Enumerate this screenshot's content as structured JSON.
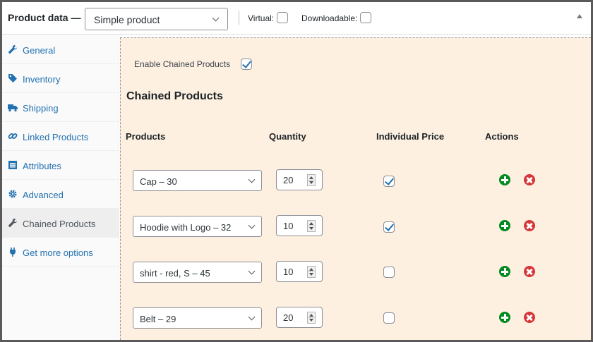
{
  "header": {
    "title": "Product data",
    "dash": "—",
    "product_type": "Simple product",
    "virtual_label": "Virtual:",
    "virtual_checked": false,
    "downloadable_label": "Downloadable:",
    "downloadable_checked": false,
    "collapse_icon": "triangle-up-icon"
  },
  "sidebar": {
    "items": [
      {
        "label": "General",
        "icon": "wrench-icon",
        "active": false
      },
      {
        "label": "Inventory",
        "icon": "tag-icon",
        "active": false
      },
      {
        "label": "Shipping",
        "icon": "truck-icon",
        "active": false
      },
      {
        "label": "Linked Products",
        "icon": "link-icon",
        "active": false
      },
      {
        "label": "Attributes",
        "icon": "list-icon",
        "active": false
      },
      {
        "label": "Advanced",
        "icon": "gear-icon",
        "active": false
      },
      {
        "label": "Chained Products",
        "icon": "wrench-icon",
        "active": true
      },
      {
        "label": "Get more options",
        "icon": "plugin-icon",
        "active": false
      }
    ]
  },
  "panel": {
    "enable_label": "Enable Chained Products",
    "enable_checked": true,
    "section_title": "Chained Products",
    "columns": [
      "Products",
      "Quantity",
      "Individual Price",
      "Actions"
    ],
    "rows": [
      {
        "product": "Cap – 30",
        "quantity": "20",
        "individual_price": true
      },
      {
        "product": "Hoodie with Logo – 32",
        "quantity": "10",
        "individual_price": true
      },
      {
        "product": "shirt - red, S – 45",
        "quantity": "10",
        "individual_price": false
      },
      {
        "product": "Belt – 29",
        "quantity": "20",
        "individual_price": false
      }
    ]
  },
  "colors": {
    "link": "#2271b1",
    "panel_bg": "#fdf0e1",
    "add": "#008a20",
    "remove": "#d63638"
  }
}
